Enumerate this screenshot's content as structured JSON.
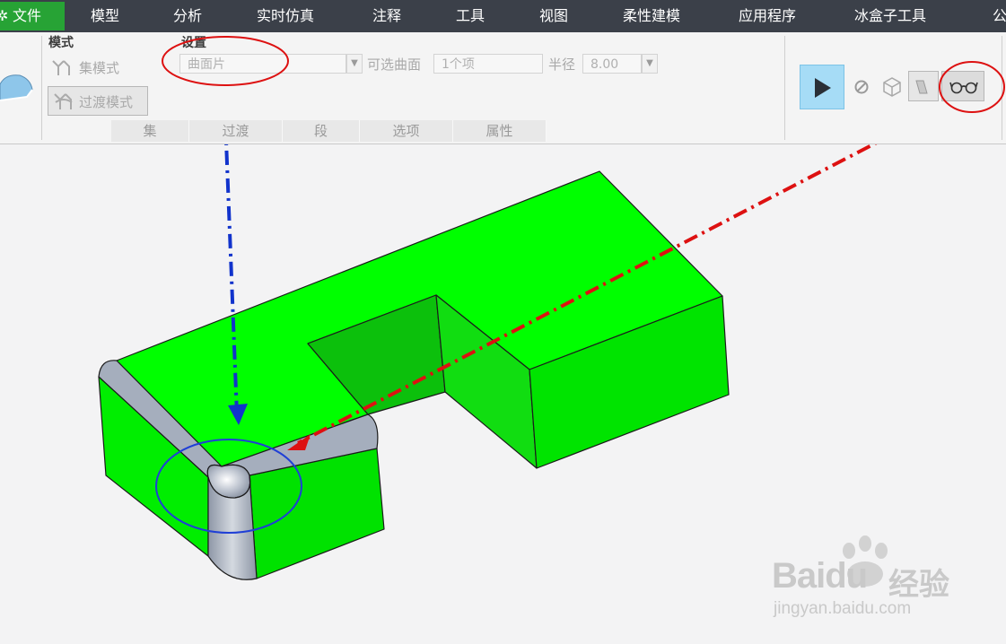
{
  "menu": {
    "file": "文件",
    "items": [
      "模型",
      "分析",
      "实时仿真",
      "注释",
      "工具",
      "视图",
      "柔性建模",
      "应用程序",
      "冰盒子工具",
      "公"
    ]
  },
  "ribbon": {
    "mode_group": {
      "title": "模式",
      "set_mode": "集模式",
      "transition_mode": "过渡模式"
    },
    "settings_group": {
      "title": "设置",
      "type_value": "曲面片",
      "optional_surface_label": "可选曲面",
      "optional_surface_value": "1个项",
      "radius_label": "半径",
      "radius_value": "8.00"
    },
    "tabs": [
      "集",
      "过渡",
      "段",
      "选项",
      "属性"
    ],
    "actions": {
      "play_icon": "play-icon",
      "pause_icon": "pause-icon",
      "preview_icon": "glasses-icon"
    }
  },
  "colors": {
    "menubar": "#3b4049",
    "file_tab": "#27a335",
    "model_green": "#00ff00",
    "fillet": "#a7b0bf",
    "annotation_red": "#dd1111",
    "annotation_blue": "#1133cc"
  },
  "watermark": {
    "brand": "Baidu",
    "product": "经验",
    "url": "jingyan.baidu.com"
  }
}
